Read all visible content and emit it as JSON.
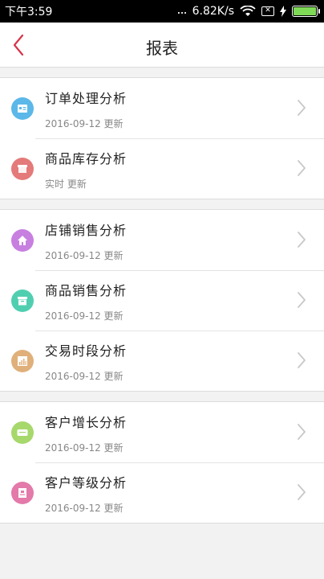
{
  "status": {
    "time": "下午3:59",
    "dots": "...",
    "speed": "6.82K/s",
    "sim_mark": "✕"
  },
  "header": {
    "title": "报表"
  },
  "groups": [
    {
      "items": [
        {
          "label": "订单处理分析",
          "updated": "2016-09-12 更新",
          "icon": "id-card-icon",
          "color": "#5bb8e8"
        },
        {
          "label": "商品库存分析",
          "updated": "实时 更新",
          "icon": "store-box-icon",
          "color": "#e47a7a"
        }
      ]
    },
    {
      "items": [
        {
          "label": "店铺销售分析",
          "updated": "2016-09-12 更新",
          "icon": "house-icon",
          "color": "#c77fe0"
        },
        {
          "label": "商品销售分析",
          "updated": "2016-09-12 更新",
          "icon": "archive-box-icon",
          "color": "#4fcfb0"
        },
        {
          "label": "交易时段分析",
          "updated": "2016-09-12 更新",
          "icon": "bar-chart-icon",
          "color": "#e0b07a"
        }
      ]
    },
    {
      "items": [
        {
          "label": "客户增长分析",
          "updated": "2016-09-12 更新",
          "icon": "growth-card-icon",
          "color": "#a6d86b"
        },
        {
          "label": "客户等级分析",
          "updated": "2016-09-12 更新",
          "icon": "badge-icon",
          "color": "#e37aa9"
        }
      ]
    }
  ],
  "colors": {
    "accent": "#d8344a",
    "chevron": "#c8c8c8"
  }
}
